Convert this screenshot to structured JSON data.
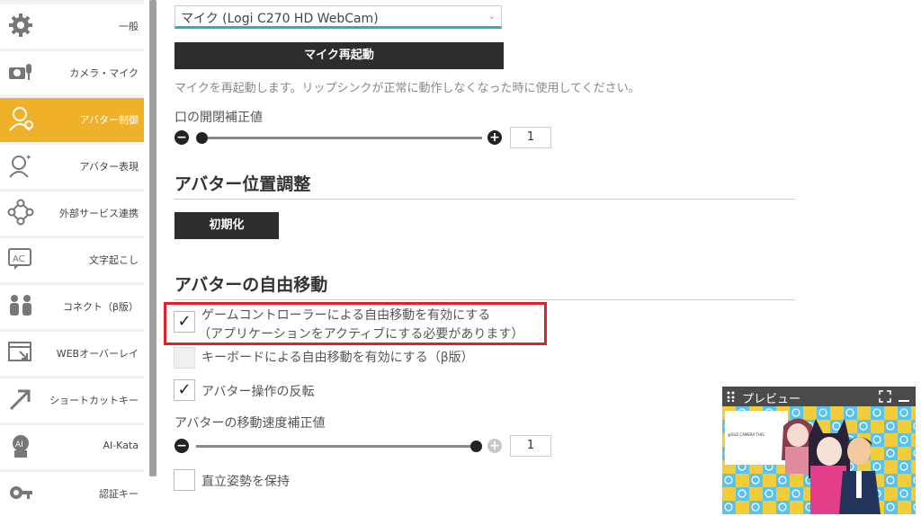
{
  "sidebar": {
    "items": [
      {
        "label": "一般",
        "icon": "gear-icon"
      },
      {
        "label": "カメラ・マイク",
        "icon": "camera-mic-icon"
      },
      {
        "label": "アバター制御",
        "icon": "avatar-control-icon",
        "active": true
      },
      {
        "label": "アバター表現",
        "icon": "avatar-expression-icon"
      },
      {
        "label": "外部サービス連携",
        "icon": "external-service-icon"
      },
      {
        "label": "文字起こし",
        "icon": "ac-transcription-icon"
      },
      {
        "label": "コネクト（β版）",
        "icon": "people-connect-icon"
      },
      {
        "label": "WEBオーバーレイ",
        "icon": "web-overlay-icon"
      },
      {
        "label": "ショートカットキー",
        "icon": "shortcut-arrow-icon"
      },
      {
        "label": "AI-Kata",
        "icon": "ai-kata-icon"
      },
      {
        "label": "認証キー",
        "icon": "key-icon"
      }
    ],
    "accent_color": "#efb12a"
  },
  "mic": {
    "select_value": "マイク (Logi C270 HD WebCam)",
    "restart_button": "マイク再起動",
    "restart_note": "マイクを再起動します。リップシンクが正常に動作しなくなった時に使用してください。"
  },
  "mouth": {
    "label": "口の開閉補正値",
    "value": "1",
    "slider_fraction": 0.0
  },
  "position": {
    "heading": "アバター位置調整",
    "reset_button": "初期化"
  },
  "free_move": {
    "heading": "アバターの自由移動",
    "gamepad_line1": "ゲームコントローラーによる自由移動を有効にする",
    "gamepad_line2": "（アプリケーションをアクティブにする必要があります）",
    "gamepad_checked": true,
    "keyboard_label": "キーボードによる自由移動を有効にする（β版）",
    "keyboard_checked": false,
    "invert_label": "アバター操作の反転",
    "invert_checked": true,
    "speed_label": "アバターの移動速度補正値",
    "speed_value": "1",
    "speed_slider_fraction": 1.0,
    "upright_label": "直立姿勢を保持",
    "upright_checked": false
  },
  "preview": {
    "title": "プレビュー",
    "inner_text": "@SUZ CAMERA THIS"
  },
  "colors": {
    "highlight_border": "#e0202a",
    "select_underline": "#2bb3a8",
    "dark_button": "#2d2d2d"
  }
}
